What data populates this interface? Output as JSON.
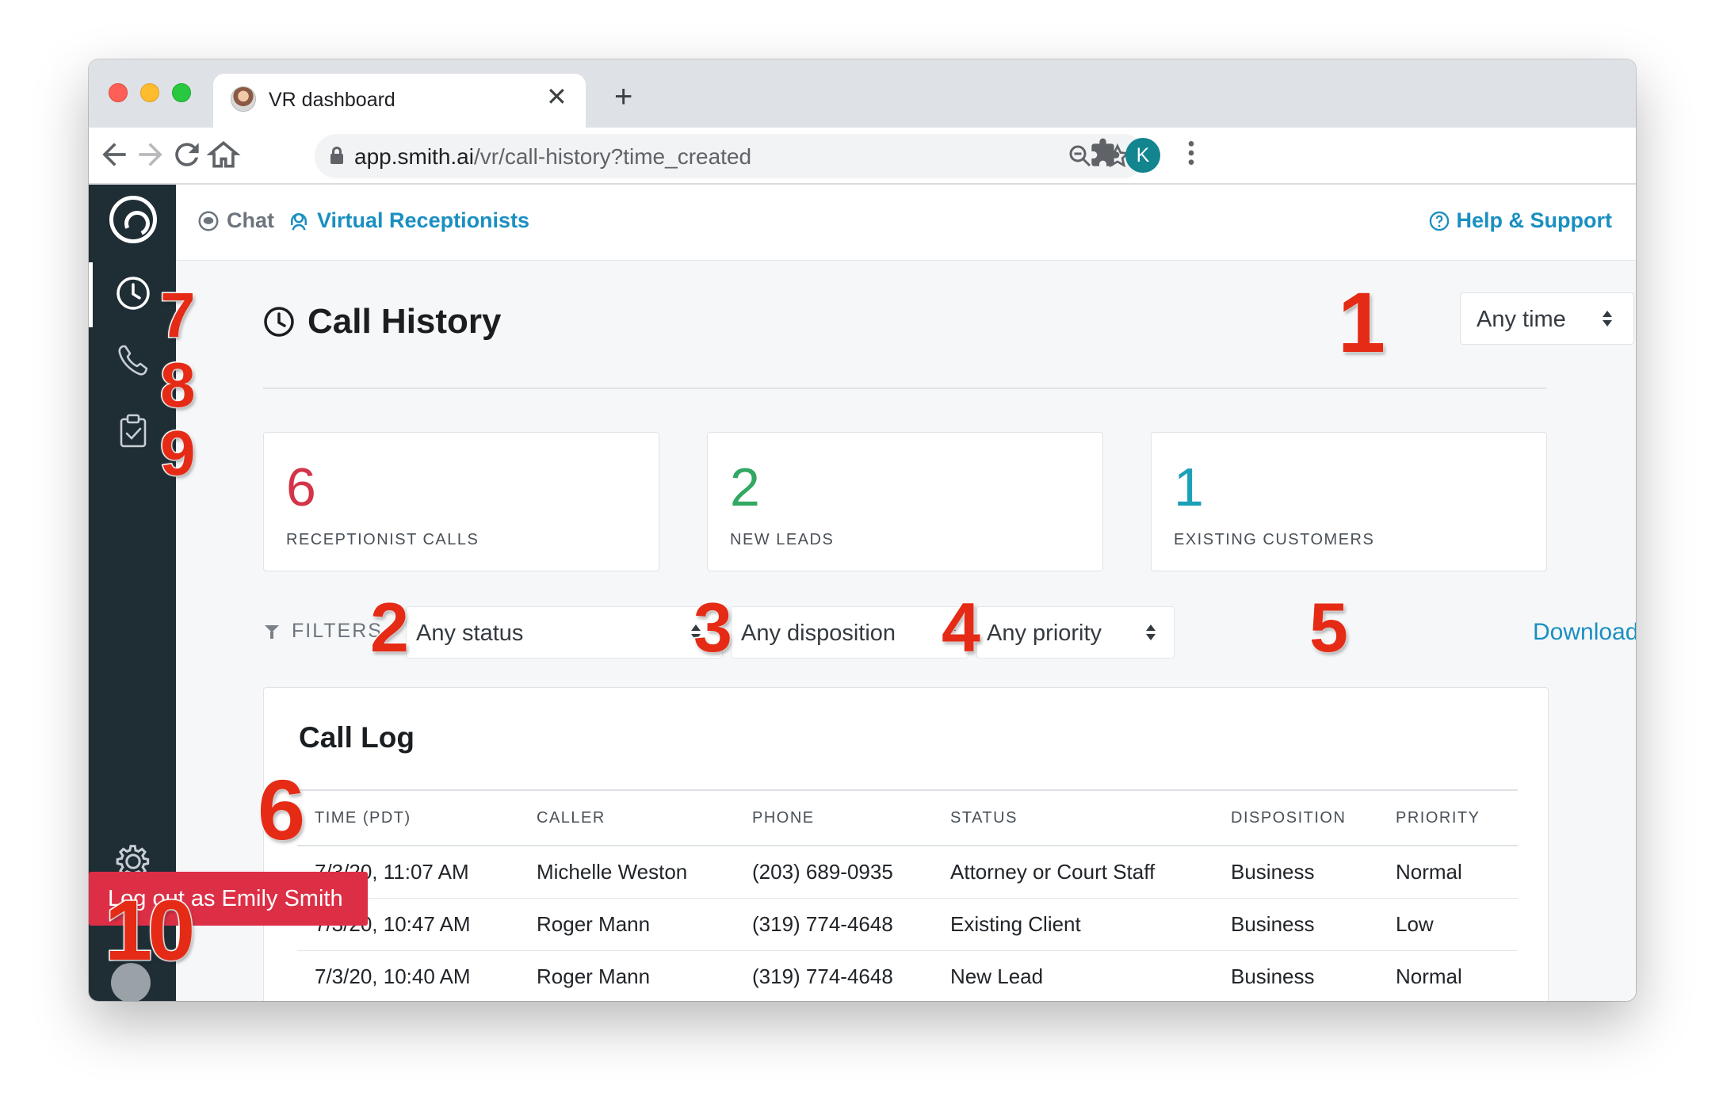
{
  "browser": {
    "tab_title": "VR dashboard",
    "tab_close": "✕",
    "new_tab": "+",
    "url_host": "app.smith.ai",
    "url_path": "/vr/call-history?time_created",
    "profile_initial": "K"
  },
  "topnav": {
    "chat_label": "Chat",
    "vr_label": "Virtual Receptionists",
    "help_label": "Help & Support"
  },
  "page": {
    "title": "Call History",
    "time_filter": "Any time"
  },
  "stats": [
    {
      "value": "6",
      "label": "RECEPTIONIST CALLS",
      "color": "#d3344a"
    },
    {
      "value": "2",
      "label": "NEW LEADS",
      "color": "#32a862"
    },
    {
      "value": "1",
      "label": "EXISTING CUSTOMERS",
      "color": "#1ba0b8"
    }
  ],
  "filters": {
    "label": "FILTERS",
    "status": "Any status",
    "disposition": "Any disposition",
    "priority": "Any priority",
    "download": "Download CSV"
  },
  "call_log": {
    "title": "Call Log",
    "columns": [
      "TIME (PDT)",
      "CALLER",
      "PHONE",
      "STATUS",
      "DISPOSITION",
      "PRIORITY"
    ],
    "rows": [
      [
        "7/3/20, 11:07 AM",
        "Michelle Weston",
        "(203) 689-0935",
        "Attorney or Court Staff",
        "Business",
        "Normal"
      ],
      [
        "7/3/20, 10:47 AM",
        "Roger Mann",
        "(319) 774-4648",
        "Existing Client",
        "Business",
        "Low"
      ],
      [
        "7/3/20, 10:40 AM",
        "Roger Mann",
        "(319) 774-4648",
        "New Lead",
        "Business",
        "Normal"
      ]
    ]
  },
  "logout": "Log out as Emily Smith",
  "callouts": [
    "1",
    "2",
    "3",
    "4",
    "5",
    "6",
    "7",
    "8",
    "9",
    "10"
  ],
  "icons": {
    "sidebar": [
      "clock-icon",
      "phone-icon",
      "clipboard-check-icon",
      "gear-icon"
    ],
    "toolbar": [
      "back-icon",
      "forward-icon",
      "reload-icon",
      "home-icon",
      "lock-icon",
      "zoom-icon",
      "star-icon",
      "extensions-icon",
      "menu-icon"
    ]
  },
  "colors": {
    "accent": "#1a8fc1",
    "sidebar": "#1f2d35",
    "logout": "#dc2f46",
    "callout": "#e52b16"
  }
}
